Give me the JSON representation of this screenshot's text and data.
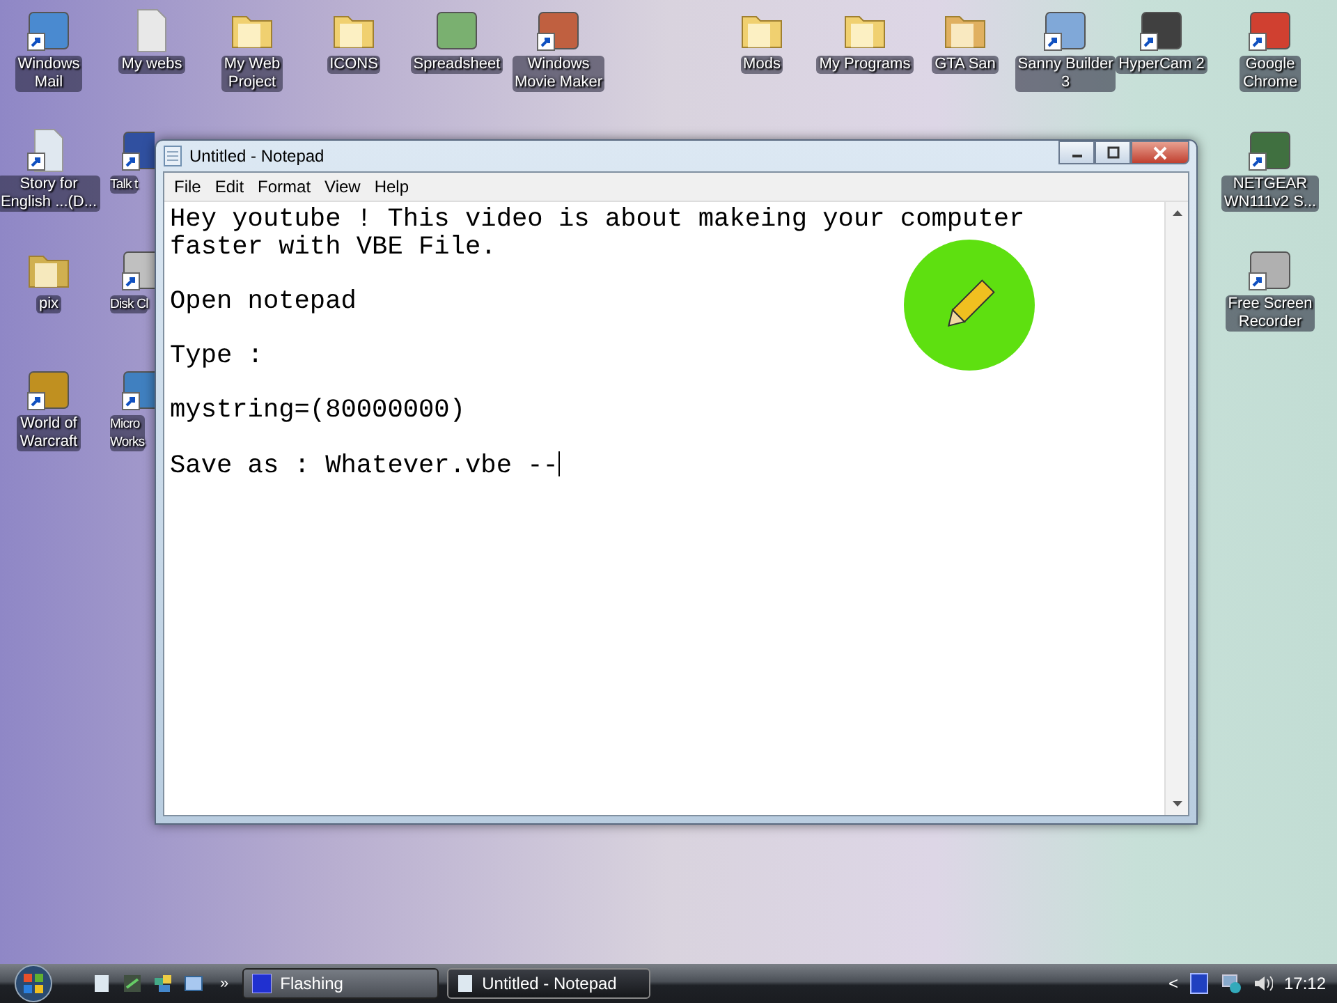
{
  "top_row_icons": [
    {
      "label": "Windows\nMail",
      "kind": "app",
      "color": "#4a8ad0",
      "shortcut": true
    },
    {
      "label": "My webs",
      "kind": "file",
      "color": "#e8e8e8",
      "shortcut": false
    },
    {
      "label": "My Web\nProject",
      "kind": "folder",
      "color": "#f0d070",
      "shortcut": false
    },
    {
      "label": "ICONS",
      "kind": "folder",
      "color": "#f0d070",
      "shortcut": false
    },
    {
      "label": "Spreadsheet",
      "kind": "app",
      "color": "#7ab070",
      "shortcut": false
    },
    {
      "label": "Windows\nMovie Maker",
      "kind": "app",
      "color": "#c06040",
      "shortcut": true
    },
    {
      "label": "Mods",
      "kind": "folder",
      "color": "#f0d070",
      "shortcut": false
    },
    {
      "label": "My Programs",
      "kind": "folder",
      "color": "#f0d070",
      "shortcut": false
    },
    {
      "label": "GTA San",
      "kind": "folder",
      "color": "#e0b060",
      "shortcut": false
    },
    {
      "label": "Sanny Builder\n3",
      "kind": "app",
      "color": "#80a8d8",
      "shortcut": true
    },
    {
      "label": "HyperCam 2",
      "kind": "app",
      "color": "#404040",
      "shortcut": true
    },
    {
      "label": "Google\nChrome",
      "kind": "app",
      "color": "#d04030",
      "shortcut": true
    }
  ],
  "left_column_icons": [
    {
      "label": "Story for\nEnglish ...(D...",
      "kind": "file",
      "color": "#e0e8f0",
      "shortcut": true
    },
    {
      "label": "pix",
      "kind": "folder",
      "color": "#d0b050",
      "shortcut": false
    },
    {
      "label": "World of\nWarcraft",
      "kind": "app",
      "color": "#c09020",
      "shortcut": true
    }
  ],
  "second_column_icons": [
    {
      "label": "Talk t",
      "kind": "app",
      "color": "#3050a0",
      "shortcut": true
    },
    {
      "label": "Disk Cl",
      "kind": "app",
      "color": "#c0c0c0",
      "shortcut": true
    },
    {
      "label": "Micro\nWorks",
      "kind": "app",
      "color": "#4080c0",
      "shortcut": true
    }
  ],
  "right_column_icons": [
    {
      "label": "NETGEAR\nWN111v2 S...",
      "kind": "app",
      "color": "#407040",
      "shortcut": true
    },
    {
      "label": "Free Screen\nRecorder",
      "kind": "app",
      "color": "#b0b0b0",
      "shortcut": true
    }
  ],
  "notepad": {
    "title": "Untitled - Notepad",
    "menu": [
      "File",
      "Edit",
      "Format",
      "View",
      "Help"
    ],
    "paragraphs": [
      "Hey youtube ! This video is about makeing your computer\nfaster with VBE File.",
      "Open notepad",
      "Type :",
      "mystring=(80000000)",
      "Save as : Whatever.vbe --"
    ]
  },
  "taskbar": {
    "quick_launch_more": "»",
    "tasks": [
      {
        "label": "Flashing",
        "selected": false
      },
      {
        "label": "Untitled - Notepad",
        "selected": true
      }
    ],
    "tray_toggle": "<",
    "clock": "17:12"
  }
}
